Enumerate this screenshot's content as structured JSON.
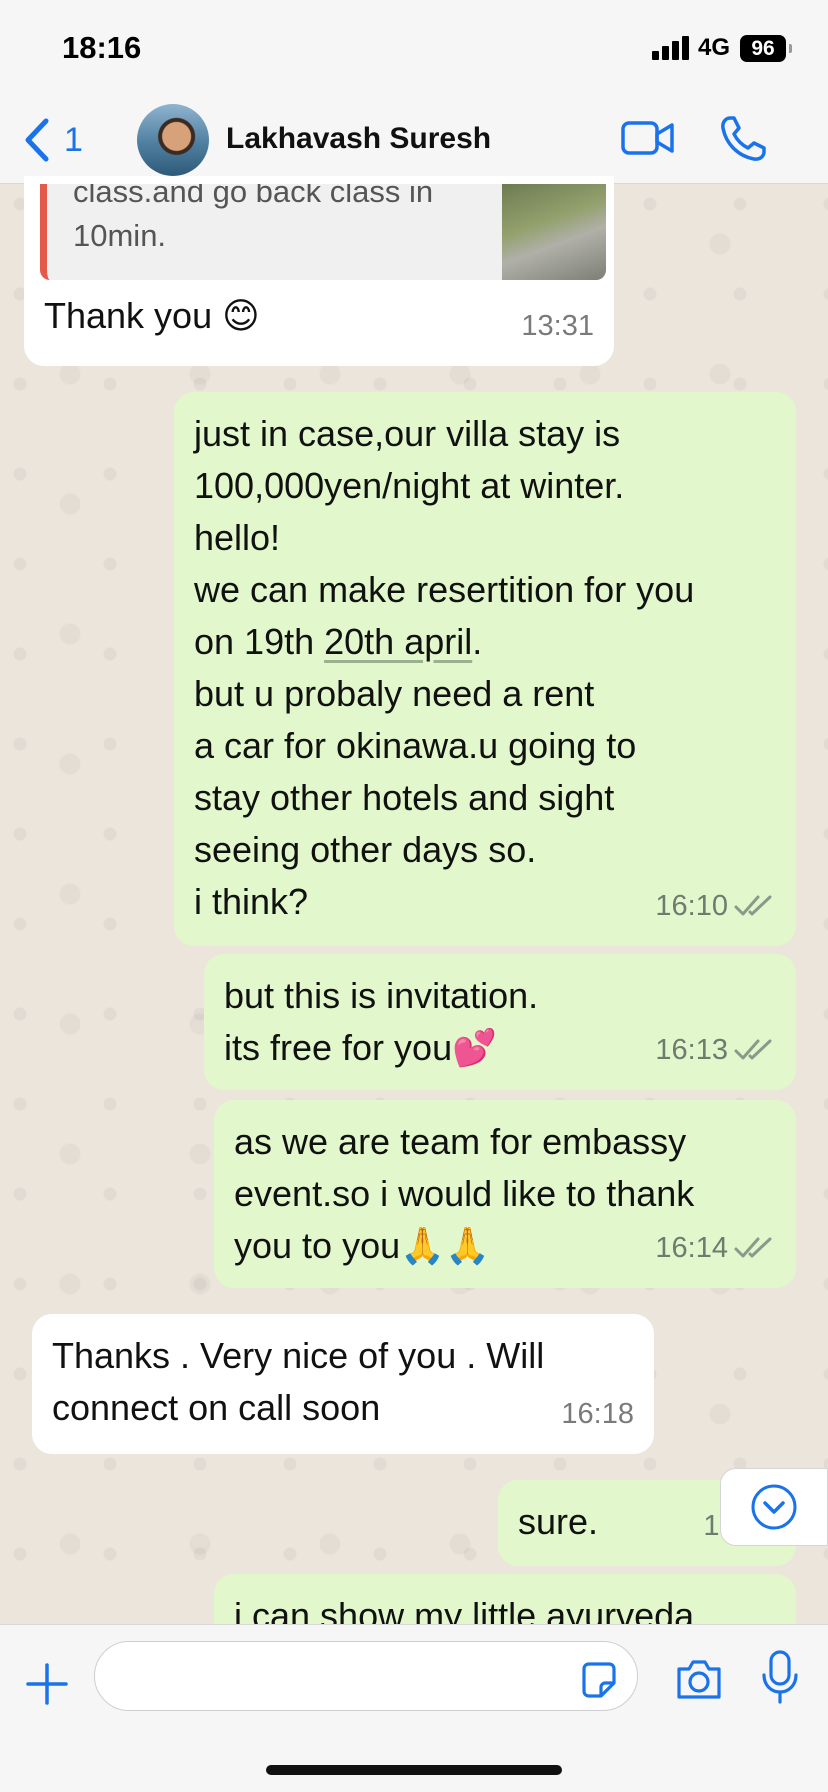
{
  "status_bar": {
    "time": "18:16",
    "network": "4G",
    "battery": "96"
  },
  "header": {
    "back_count": "1",
    "contact_name": "Lakhavash Suresh"
  },
  "quoted_reply": {
    "text": "class.and go back class in\n10min."
  },
  "messages": [
    {
      "dir": "in",
      "text": "Thank you 😊",
      "time": "13:31"
    },
    {
      "dir": "out",
      "text_before_link": "just in case,our villa stay is\n100,000yen/night at winter.\nhello!\nwe can make resertition for you\non 19th ",
      "link": "20th april",
      "text_after_link": ".\nbut u probaly need a rent\na car for okinawa.u going to\nstay other hotels and sight\nseeing other days so.\ni think?",
      "time": "16:10"
    },
    {
      "dir": "out",
      "text": "but this is invitation.\nits free for you💕",
      "time": "16:13"
    },
    {
      "dir": "out",
      "text": "as we are team for embassy\nevent.so i would like to thank\nyou to you🙏🙏",
      "time": "16:14"
    },
    {
      "dir": "in",
      "text": "Thanks . Very nice of you . Will\nconnect on call soon",
      "time": "16:18"
    },
    {
      "dir": "out",
      "text": "sure.",
      "time": "16:19"
    },
    {
      "dir": "out",
      "text": "i can show my little ayurveda"
    }
  ],
  "input": {
    "placeholder": ""
  },
  "colors": {
    "accent": "#1a73e8",
    "outgoing_bubble": "#e2f7cb",
    "incoming_bubble": "#ffffff",
    "quote_bar": "#e45a4a"
  },
  "icons": [
    "back-chevron-icon",
    "video-camera-icon",
    "phone-icon",
    "double-check-icon",
    "chevron-down-circle-icon",
    "plus-icon",
    "sticker-icon",
    "camera-icon",
    "microphone-icon"
  ]
}
